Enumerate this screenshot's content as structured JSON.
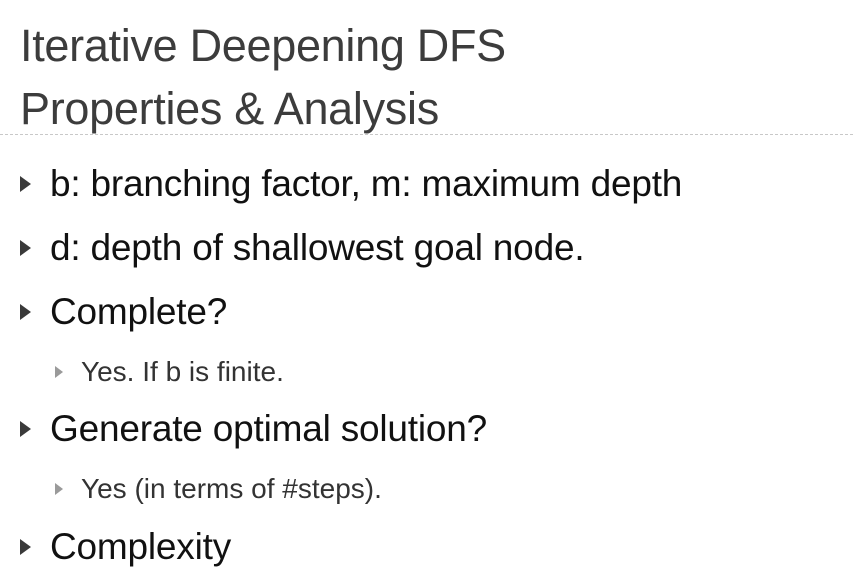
{
  "slide": {
    "title_lines": [
      "Iterative Deepening DFS",
      "Properties & Analysis"
    ],
    "bullets": [
      {
        "level": 1,
        "text": "b: branching factor, m: maximum depth"
      },
      {
        "level": 1,
        "text": "d: depth of shallowest goal node."
      },
      {
        "level": 1,
        "text": "Complete?"
      },
      {
        "level": 2,
        "text": "Yes. If b is finite."
      },
      {
        "level": 1,
        "text": "Generate optimal solution?"
      },
      {
        "level": 2,
        "text": "Yes (in terms of #steps)."
      },
      {
        "level": 1,
        "text": "Complexity"
      }
    ]
  }
}
